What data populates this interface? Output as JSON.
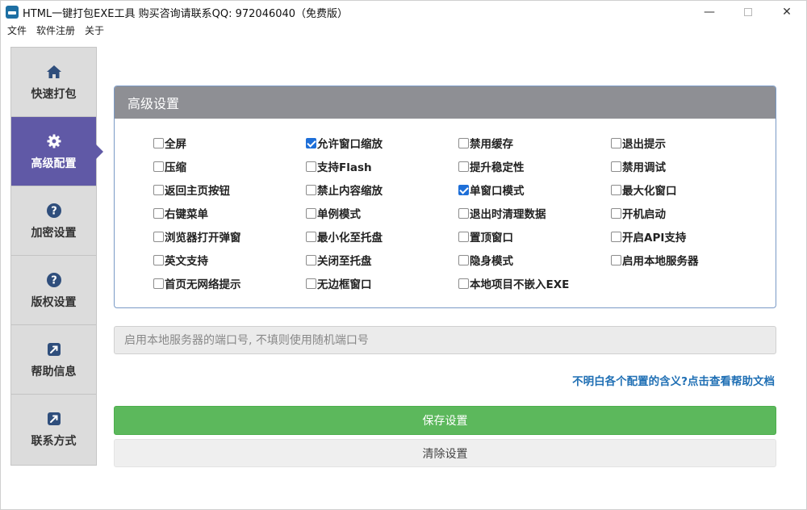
{
  "window": {
    "title": "HTML一键打包EXE工具 购买咨询请联系QQ: 972046040（免费版）",
    "controls": {
      "minimize": "—",
      "close": "✕"
    }
  },
  "menu": [
    "文件",
    "软件注册",
    "关于"
  ],
  "sidebar": {
    "items": [
      {
        "label": "快速打包",
        "icon": "home-icon",
        "active": false
      },
      {
        "label": "高级配置",
        "icon": "gear-icon",
        "active": true
      },
      {
        "label": "加密设置",
        "icon": "question-circle-icon",
        "active": false
      },
      {
        "label": "版权设置",
        "icon": "question-circle-icon",
        "active": false
      },
      {
        "label": "帮助信息",
        "icon": "external-link-icon",
        "active": false
      },
      {
        "label": "联系方式",
        "icon": "external-link-icon",
        "active": false
      }
    ]
  },
  "panel": {
    "title": "高级设置",
    "columns": [
      [
        {
          "label": "全屏",
          "checked": false
        },
        {
          "label": "压缩",
          "checked": false
        },
        {
          "label": "返回主页按钮",
          "checked": false
        },
        {
          "label": "右键菜单",
          "checked": false
        },
        {
          "label": "浏览器打开弹窗",
          "checked": false
        },
        {
          "label": "英文支持",
          "checked": false
        },
        {
          "label": "首页无网络提示",
          "checked": false
        }
      ],
      [
        {
          "label": "允许窗口缩放",
          "checked": true
        },
        {
          "label": "支持Flash",
          "checked": false
        },
        {
          "label": "禁止内容缩放",
          "checked": false
        },
        {
          "label": "单例模式",
          "checked": false
        },
        {
          "label": "最小化至托盘",
          "checked": false
        },
        {
          "label": "关闭至托盘",
          "checked": false
        },
        {
          "label": "无边框窗口",
          "checked": false
        }
      ],
      [
        {
          "label": "禁用缓存",
          "checked": false
        },
        {
          "label": "提升稳定性",
          "checked": false
        },
        {
          "label": "单窗口模式",
          "checked": true
        },
        {
          "label": "退出时清理数据",
          "checked": false
        },
        {
          "label": "置顶窗口",
          "checked": false
        },
        {
          "label": "隐身模式",
          "checked": false
        },
        {
          "label": "本地项目不嵌入EXE",
          "checked": false
        }
      ],
      [
        {
          "label": "退出提示",
          "checked": false
        },
        {
          "label": "禁用调试",
          "checked": false
        },
        {
          "label": "最大化窗口",
          "checked": false
        },
        {
          "label": "开机启动",
          "checked": false
        },
        {
          "label": "开启API支持",
          "checked": false
        },
        {
          "label": "启用本地服务器",
          "checked": false
        }
      ]
    ]
  },
  "port": {
    "value": "",
    "placeholder": "启用本地服务器的端口号, 不填则使用随机端口号"
  },
  "help_link": "不明白各个配置的含义?点击查看帮助文档",
  "buttons": {
    "save": "保存设置",
    "clear": "清除设置"
  },
  "colors": {
    "accent": "#6059a6",
    "save": "#5cb85c",
    "link": "#1f6fb4",
    "panel_header": "#8e8f94"
  }
}
